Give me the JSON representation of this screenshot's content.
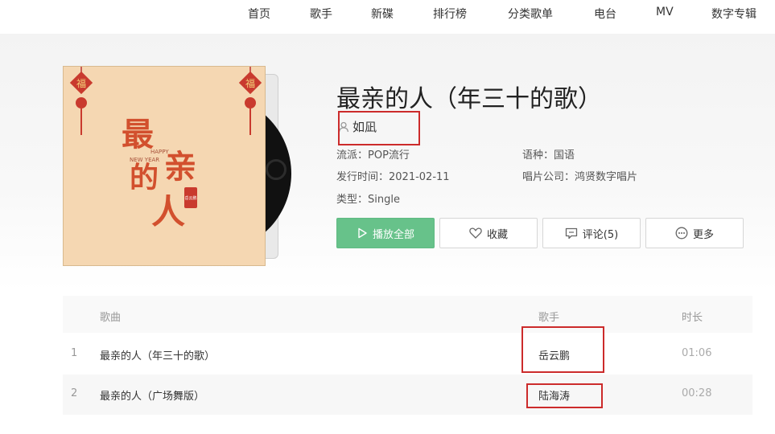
{
  "nav": {
    "items": [
      "首页",
      "歌手",
      "新碟",
      "排行榜",
      "分类歌单",
      "电台",
      "MV",
      "数字专辑"
    ]
  },
  "album": {
    "title": "最亲的人（年三十的歌）",
    "singer": "如凪",
    "genre_label": "流派：",
    "genre": "POP流行",
    "language_label": "语种：",
    "language": "国语",
    "release_label": "发行时间：",
    "release_date": "2021-02-11",
    "company_label": "唱片公司：",
    "company": "鸿贤数字唱片",
    "type_label": "类型：",
    "type": "Single",
    "cover": {
      "fu_char": "福",
      "title_lines": [
        "最",
        "亲",
        "的",
        "人"
      ],
      "happy": "HAPPY",
      "new_year": "NEW YEAR",
      "seal": "岳云鹏"
    }
  },
  "actions": {
    "play_all": "播放全部",
    "favorite": "收藏",
    "comment": "评论(5)",
    "more": "更多"
  },
  "songs": {
    "headers": {
      "song": "歌曲",
      "artist": "歌手",
      "duration": "时长"
    },
    "rows": [
      {
        "index": "1",
        "title": "最亲的人（年三十的歌）",
        "artist": "岳云鹏",
        "duration": "01:06"
      },
      {
        "index": "2",
        "title": "最亲的人（广场舞版）",
        "artist": "陆海涛",
        "duration": "00:28"
      }
    ]
  },
  "colors": {
    "accent_green": "#67c28a",
    "highlight_red": "#cc2b2b",
    "cover_bg": "#f5d7b2",
    "cover_text": "#d2502e"
  }
}
